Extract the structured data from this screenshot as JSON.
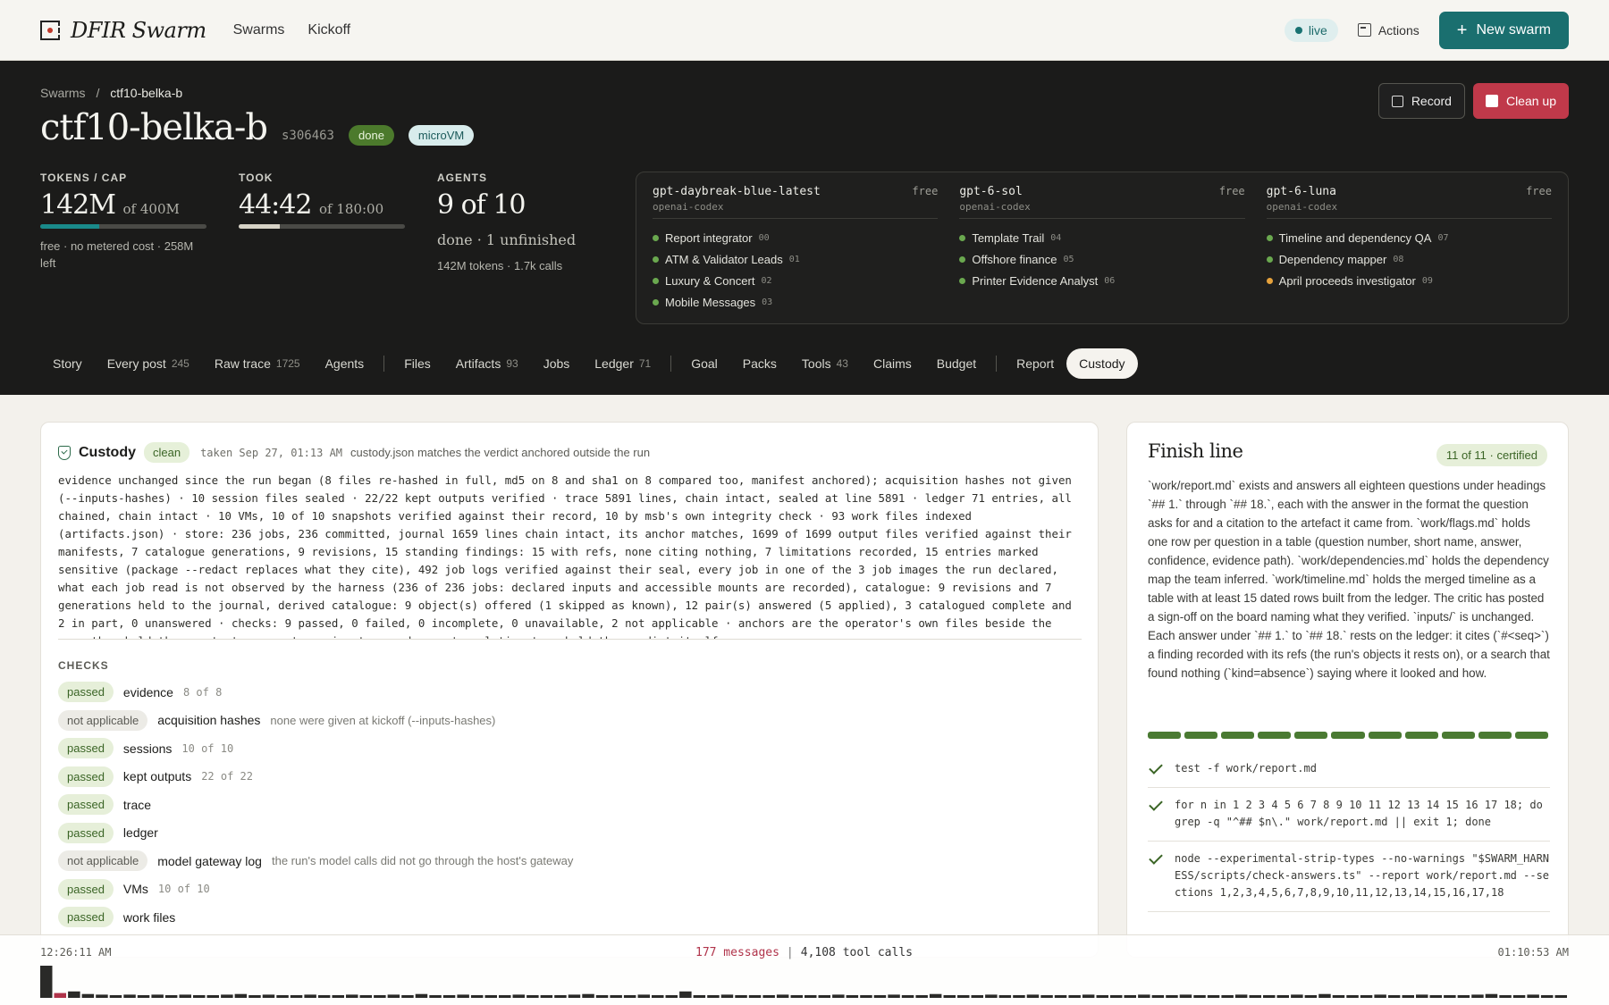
{
  "app": {
    "name": "DFIR Swarm",
    "nav": [
      "Swarms",
      "Kickoff"
    ],
    "live_label": "live",
    "actions_label": "Actions",
    "new_swarm_label": "New swarm",
    "accent": "#1a6f6f"
  },
  "breadcrumb": {
    "root": "Swarms",
    "current": "ctf10-belka-b"
  },
  "swarm": {
    "title": "ctf10-belka-b",
    "id": "s306463",
    "status": "done",
    "runtime": "microVM",
    "record_label": "Record",
    "cleanup_label": "Clean up"
  },
  "stats": {
    "tokens": {
      "label": "TOKENS / CAP",
      "value": "142M",
      "of": "of 400M",
      "fraction": 0.355,
      "note": "free · no metered cost · 258M left",
      "color": "#1a8a8a"
    },
    "took": {
      "label": "TOOK",
      "value": "44:42",
      "of": "of 180:00",
      "fraction": 0.248,
      "color": "#d6d2c6"
    },
    "agents": {
      "label": "AGENTS",
      "value": "9 of 10",
      "sub": "done · 1 unfinished",
      "note": "142M tokens · 1.7k calls"
    }
  },
  "models": [
    {
      "name": "gpt-daybreak-blue-latest",
      "provider": "openai-codex",
      "tier": "free",
      "agents": [
        {
          "name": "Report integrator",
          "num": "00",
          "state": "ok"
        },
        {
          "name": "ATM & Validator Leads",
          "num": "01",
          "state": "ok"
        },
        {
          "name": "Luxury & Concert",
          "num": "02",
          "state": "ok"
        },
        {
          "name": "Mobile Messages",
          "num": "03",
          "state": "ok"
        }
      ]
    },
    {
      "name": "gpt-6-sol",
      "provider": "openai-codex",
      "tier": "free",
      "agents": [
        {
          "name": "Template Trail",
          "num": "04",
          "state": "ok"
        },
        {
          "name": "Offshore finance",
          "num": "05",
          "state": "ok"
        },
        {
          "name": "Printer Evidence Analyst",
          "num": "06",
          "state": "ok"
        }
      ]
    },
    {
      "name": "gpt-6-luna",
      "provider": "openai-codex",
      "tier": "free",
      "agents": [
        {
          "name": "Timeline and dependency QA",
          "num": "07",
          "state": "ok"
        },
        {
          "name": "Dependency mapper",
          "num": "08",
          "state": "ok"
        },
        {
          "name": "April proceeds investigator",
          "num": "09",
          "state": "warn"
        }
      ]
    }
  ],
  "tabs": [
    {
      "label": "Story",
      "count": ""
    },
    {
      "label": "Every post",
      "count": "245"
    },
    {
      "label": "Raw trace",
      "count": "1725"
    },
    {
      "label": "Agents",
      "count": ""
    },
    {
      "sep": true
    },
    {
      "label": "Files",
      "count": ""
    },
    {
      "label": "Artifacts",
      "count": "93"
    },
    {
      "label": "Jobs",
      "count": ""
    },
    {
      "label": "Ledger",
      "count": "71"
    },
    {
      "sep": true
    },
    {
      "label": "Goal",
      "count": ""
    },
    {
      "label": "Packs",
      "count": ""
    },
    {
      "label": "Tools",
      "count": "43"
    },
    {
      "label": "Claims",
      "count": ""
    },
    {
      "label": "Budget",
      "count": ""
    },
    {
      "sep": true
    },
    {
      "label": "Report",
      "count": ""
    },
    {
      "label": "Custody",
      "count": "",
      "active": true
    }
  ],
  "custody": {
    "title": "Custody",
    "status": "clean",
    "taken": "taken Sep 27, 01:13 AM",
    "match": "custody.json matches the verdict anchored outside the run",
    "summary": "evidence unchanged since the run began (8 files re-hashed in full, md5 on 8 and sha1 on 8 compared too, manifest anchored); acquisition hashes not given (--inputs-hashes) · 10 session files sealed · 22/22 kept outputs verified · trace 5891 lines, chain intact, sealed at line 5891 · ledger 71 entries, all chained, chain intact · 10 VMs, 10 of 10 snapshots verified against their record, 10 by msb's own integrity check · 93 work files indexed (artifacts.json) · store: 236 jobs, 236 committed, journal 1659 lines chain intact, its anchor matches, 1699 of 1699 output files verified against their manifests, 7 catalogue generations, 9 revisions, 15 standing findings: 15 with refs, none citing nothing, 7 limitations recorded, 15 entries marked sensitive (package --redact replaces what they cite), 492 job logs verified against their seal, every job in one of the 3 job images the run declared, what each job read is not observed by the harness (236 of 236 jobs: declared inputs and accessible mounts are recorded), catalogue: 9 revisions and 7 generations held to the journal, derived catalogue: 9 object(s) offered (1 skipped as known), 12 pair(s) answered (5 applied), 3 catalogued complete and 2 in part, 0 unanswered · checks: 9 passed, 0 failed, 0 incomplete, 0 unavailable, 2 not applicable · anchors are the operator's own files beside the run: they hold the agents to account; a signature and an external timestamp hold the verdict itself",
    "checks_label": "CHECKS",
    "checks": [
      {
        "status": "passed",
        "name": "evidence",
        "detail": "8 of 8",
        "note": ""
      },
      {
        "status": "not applicable",
        "name": "acquisition hashes",
        "detail": "",
        "note": "none were given at kickoff (--inputs-hashes)"
      },
      {
        "status": "passed",
        "name": "sessions",
        "detail": "10 of 10",
        "note": ""
      },
      {
        "status": "passed",
        "name": "kept outputs",
        "detail": "22 of 22",
        "note": ""
      },
      {
        "status": "passed",
        "name": "trace",
        "detail": "",
        "note": ""
      },
      {
        "status": "passed",
        "name": "ledger",
        "detail": "",
        "note": ""
      },
      {
        "status": "not applicable",
        "name": "model gateway log",
        "detail": "",
        "note": "the run's model calls did not go through the host's gateway"
      },
      {
        "status": "passed",
        "name": "VMs",
        "detail": "10 of 10",
        "note": ""
      },
      {
        "status": "passed",
        "name": "work files",
        "detail": "",
        "note": ""
      }
    ]
  },
  "finish": {
    "title": "Finish line",
    "badge": "11 of 11 · certified",
    "text": "`work/report.md` exists and answers all eighteen questions under headings `## 1.` through `## 18.`, each with the answer in the format the question asks for and a citation to the artefact it came from. `work/flags.md` holds one row per question in a table (question number, short name, answer, confidence, evidence path). `work/dependencies.md` holds the dependency map the team inferred. `work/timeline.md` holds the merged timeline as a table with at least 15 dated rows built from the ledger. The critic has posted a sign-off on the board naming what they verified. `inputs/` is unchanged. Each answer under `## 1.` to `## 18.` rests on the ledger: it cites (`#<seq>`) a finding recorded with its refs (the run's objects it rests on), or a search that found nothing (`kind=absence`) saying where it looked and how.",
    "segments_done": 11,
    "segments_total": 11,
    "commands": [
      "test -f work/report.md",
      "for n in 1 2 3 4 5 6 7 8 9 10 11 12 13 14 15 16 17 18; do grep -q \"^## $n\\.\" work/report.md || exit 1; done",
      "node --experimental-strip-types --no-warnings \"$SWARM_HARNESS/scripts/check-answers.ts\" --report work/report.md --sections 1,2,3,4,5,6,7,8,9,10,11,12,13,14,15,16,17,18"
    ]
  },
  "timeline": {
    "start": "12:26:11 AM",
    "end": "01:10:53 AM",
    "messages": "177 messages",
    "tool_calls": "4,108 tool calls",
    "activity": [
      1.0,
      0.15,
      0.2,
      0.12,
      0.1,
      0.08,
      0.1,
      0.08,
      0.1,
      0.08,
      0.1,
      0.06,
      0.08,
      0.1,
      0.12,
      0.08,
      0.1,
      0.06,
      0.08,
      0.1,
      0.06,
      0.08,
      0.1,
      0.08,
      0.06,
      0.1,
      0.08,
      0.12,
      0.08,
      0.06,
      0.1,
      0.08,
      0.06,
      0.08,
      0.1,
      0.08,
      0.06,
      0.08,
      0.1,
      0.12,
      0.08,
      0.06,
      0.08,
      0.1,
      0.06,
      0.08,
      0.2,
      0.08,
      0.06,
      0.1,
      0.08,
      0.06,
      0.08,
      0.1,
      0.06,
      0.08,
      0.06,
      0.1,
      0.08,
      0.06,
      0.08,
      0.1,
      0.06,
      0.08,
      0.12,
      0.08,
      0.06,
      0.08,
      0.1,
      0.06,
      0.08,
      0.1,
      0.06,
      0.08,
      0.06,
      0.1,
      0.08,
      0.06,
      0.08,
      0.1,
      0.06,
      0.08,
      0.1,
      0.06,
      0.08,
      0.06,
      0.1,
      0.08,
      0.06,
      0.08,
      0.1,
      0.06,
      0.12,
      0.08,
      0.06,
      0.08,
      0.1,
      0.06,
      0.08,
      0.1,
      0.06,
      0.08,
      0.06,
      0.1,
      0.12,
      0.06,
      0.08,
      0.1,
      0.06,
      0.08
    ]
  }
}
